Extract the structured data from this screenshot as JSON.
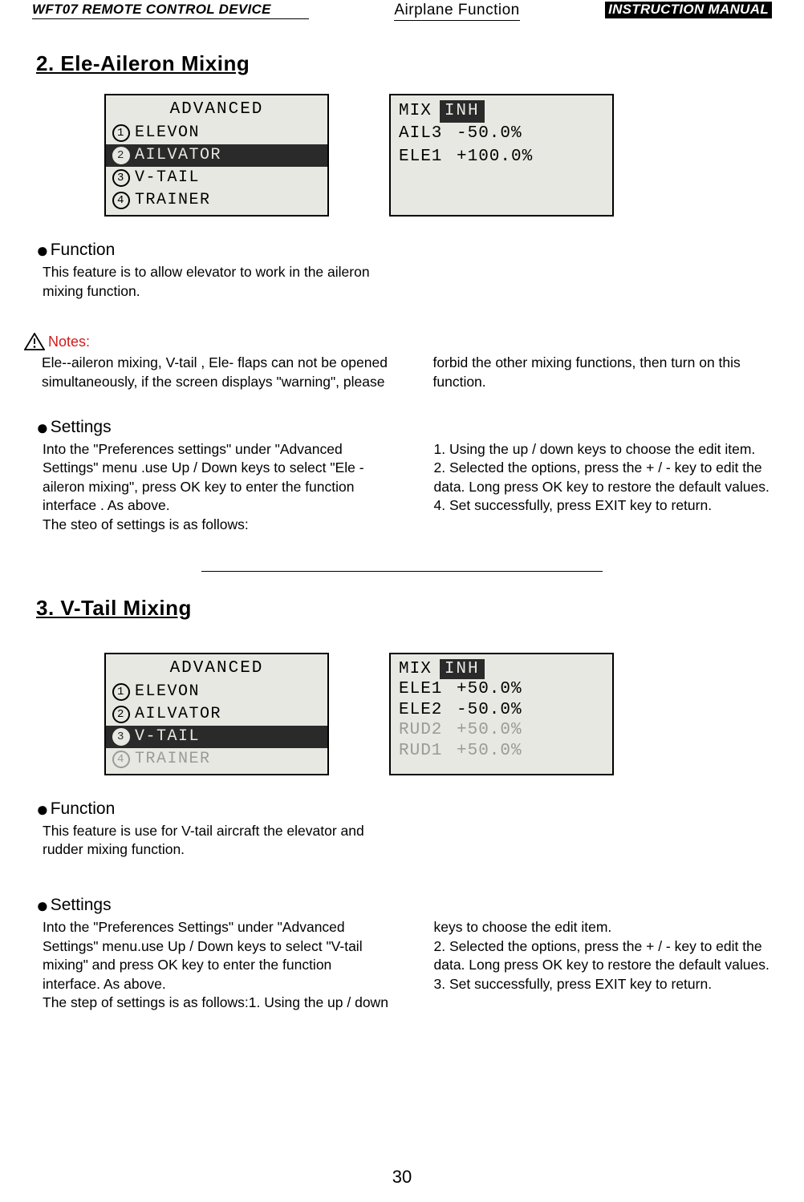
{
  "header": {
    "left": "WFT07 REMOTE CONTROL DEVICE",
    "center": "Airplane Function",
    "right": "INSTRUCTION MANUAL"
  },
  "section1": {
    "title": "2. Ele-Aileron Mixing",
    "lcd_menu": {
      "title": "ADVANCED",
      "items": [
        {
          "num": "1",
          "label": "ELEVON",
          "selected": false
        },
        {
          "num": "2",
          "label": "AILVATOR",
          "selected": true
        },
        {
          "num": "3",
          "label": "V-TAIL",
          "selected": false
        },
        {
          "num": "4",
          "label": "TRAINER",
          "selected": false
        }
      ]
    },
    "lcd_values": {
      "mix_label": "MIX",
      "mix_state": "INH",
      "rows": [
        {
          "label": "AIL3",
          "value": "-50.0%"
        },
        {
          "label": "ELE1",
          "value": "+100.0%"
        }
      ]
    },
    "function_heading": "Function",
    "function_text": "This feature is to allow elevator to work in the aileron mixing function.",
    "notes_heading": "Notes:",
    "notes_text": "Ele--aileron mixing, V-tail , Ele- flaps can not be opened simultaneously, if the screen displays \"warning\", please forbid the other mixing functions, then turn on this function.",
    "settings_heading": "Settings",
    "settings_text": "Into the \"Preferences settings\" under \"Advanced Settings\" menu .use Up / Down keys to select \"Ele - aileron mixing\", press OK key to enter the function interface . As above.\nThe steo of settings is as follows:\n1. Using the up / down keys to choose the edit item.\n2. Selected the options, press the + / - key to edit the data. Long press OK key to restore the default values.\n4. Set successfully, press EXIT key to return."
  },
  "section2": {
    "title": "3. V-Tail Mixing",
    "lcd_menu": {
      "title": "ADVANCED",
      "items": [
        {
          "num": "1",
          "label": "ELEVON",
          "selected": false
        },
        {
          "num": "2",
          "label": "AILVATOR",
          "selected": false
        },
        {
          "num": "3",
          "label": "V-TAIL",
          "selected": true
        },
        {
          "num": "4",
          "label": "TRAINER",
          "selected": false,
          "dim": true
        }
      ]
    },
    "lcd_values": {
      "mix_label": "MIX",
      "mix_state": "INH",
      "rows": [
        {
          "label": "ELE1",
          "value": "+50.0%"
        },
        {
          "label": "ELE2",
          "value": "-50.0%"
        },
        {
          "label": "RUD2",
          "value": "+50.0%",
          "dim": true
        },
        {
          "label": "RUD1",
          "value": "+50.0%",
          "dim": true
        }
      ]
    },
    "function_heading": "Function",
    "function_text": "This feature is use for V-tail aircraft the elevator and rudder mixing function.",
    "settings_heading": "Settings",
    "settings_text": "Into the \"Preferences Settings\" under \"Advanced Settings\" menu.use Up / Down keys to select \"V-tail mixing\" and press OK key to enter the function interface. As above.\nThe step of settings is as follows:1. Using the up / down keys to choose the edit item.\n2. Selected the options, press the + / - key to edit the data. Long press OK key to restore the default values.\n3. Set successfully, press EXIT key to return."
  },
  "page_number": "30"
}
